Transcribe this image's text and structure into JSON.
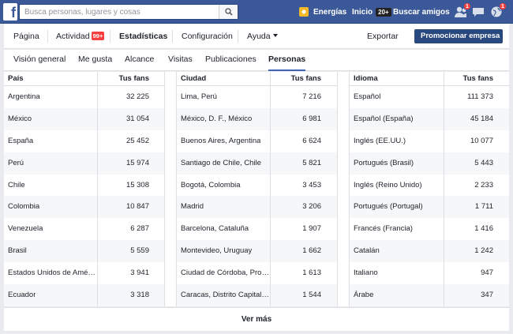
{
  "topbar": {
    "logo": "f",
    "search_placeholder": "Busca personas, lugares y cosas",
    "energy_label": "Energías",
    "home_label": "Inicio",
    "home_count": "20+",
    "find_friends_label": "Buscar amigos",
    "friend_requests_count": "1",
    "messages_count": "",
    "notifications_count": "1",
    "brand_color": "#3b5998"
  },
  "pagebar": {
    "items": [
      {
        "label": "Página"
      },
      {
        "label": "Actividad"
      },
      {
        "label": "Estadísticas"
      },
      {
        "label": "Configuración"
      },
      {
        "label": "Ayuda"
      }
    ],
    "activity_badge": "99+",
    "export_label": "Exportar",
    "promote_label": "Promocionar empresa"
  },
  "tabs": [
    {
      "label": "Visión general"
    },
    {
      "label": "Me gusta"
    },
    {
      "label": "Alcance"
    },
    {
      "label": "Visitas"
    },
    {
      "label": "Publicaciones"
    },
    {
      "label": "Personas"
    }
  ],
  "tables": [
    {
      "col1": "País",
      "col2": "Tus fans",
      "rows": [
        [
          "Argentina",
          "32 225"
        ],
        [
          "México",
          "31 054"
        ],
        [
          "España",
          "25 452"
        ],
        [
          "Perú",
          "15 974"
        ],
        [
          "Chile",
          "15 308"
        ],
        [
          "Colombia",
          "10 847"
        ],
        [
          "Venezuela",
          "6 287"
        ],
        [
          "Brasil",
          "5 559"
        ],
        [
          "Estados Unidos de América",
          "3 941"
        ],
        [
          "Ecuador",
          "3 318"
        ]
      ]
    },
    {
      "col1": "Ciudad",
      "col2": "Tus fans",
      "rows": [
        [
          "Lima, Perú",
          "7 216"
        ],
        [
          "México, D. F., México",
          "6 981"
        ],
        [
          "Buenos Aires, Argentina",
          "6 624"
        ],
        [
          "Santiago de Chile, Chile",
          "5 821"
        ],
        [
          "Bogotá, Colombia",
          "3 453"
        ],
        [
          "Madrid",
          "3 206"
        ],
        [
          "Barcelona, Cataluña",
          "1 907"
        ],
        [
          "Montevideo, Uruguay",
          "1 662"
        ],
        [
          "Ciudad de Córdoba, Provi...",
          "1 613"
        ],
        [
          "Caracas, Distrito Capital, ...",
          "1 544"
        ]
      ]
    },
    {
      "col1": "Idioma",
      "col2": "Tus fans",
      "rows": [
        [
          "Español",
          "111 373"
        ],
        [
          "Español (España)",
          "45 184"
        ],
        [
          "Inglés (EE.UU.)",
          "10 077"
        ],
        [
          "Portugués (Brasil)",
          "5 443"
        ],
        [
          "Inglés (Reino Unido)",
          "2 233"
        ],
        [
          "Portugués (Portugal)",
          "1 711"
        ],
        [
          "Francés (Francia)",
          "1 416"
        ],
        [
          "Catalán",
          "1 242"
        ],
        [
          "Italiano",
          "947"
        ],
        [
          "Árabe",
          "347"
        ]
      ]
    }
  ],
  "more_label": "Ver más"
}
